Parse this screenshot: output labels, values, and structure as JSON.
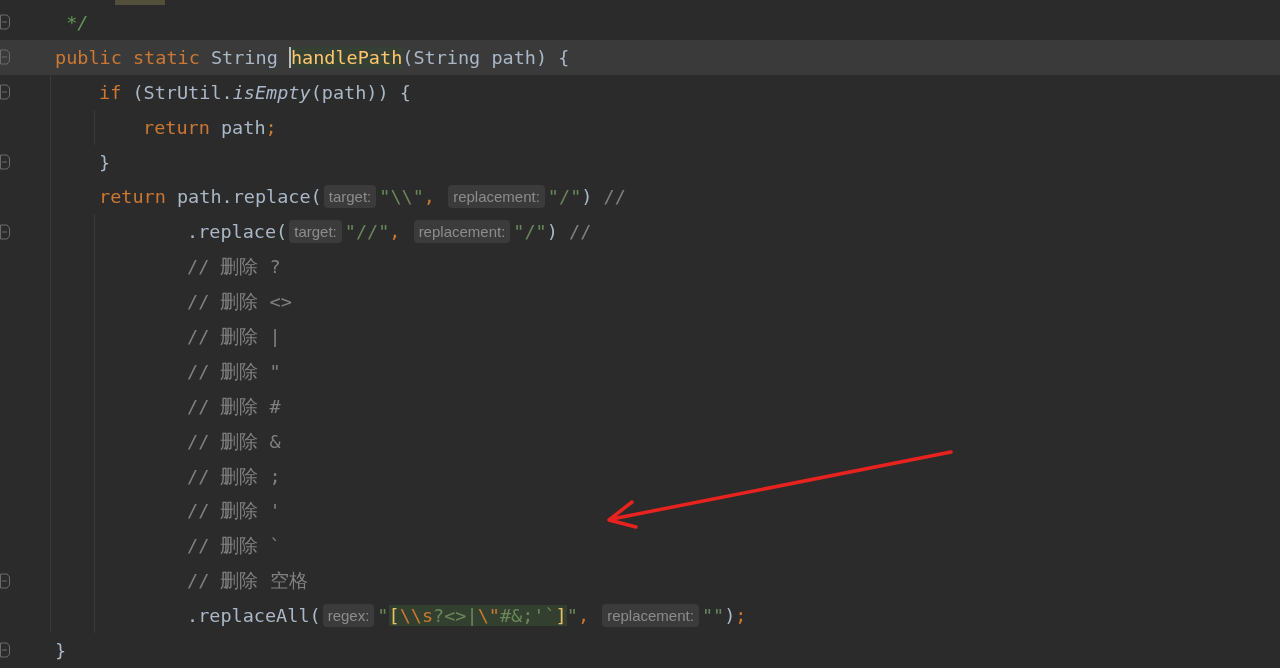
{
  "editor": {
    "lines": [
      {
        "kind": "code",
        "fold": true,
        "current": false,
        "tokens": [
          {
            "kind": "doc",
            "text": " */"
          }
        ]
      },
      {
        "kind": "code",
        "fold": true,
        "current": true,
        "tokens": [
          {
            "kind": "kw",
            "text": "public static "
          },
          {
            "kind": "plain",
            "text": "String "
          },
          {
            "kind": "method-decl",
            "text": "handlePath",
            "caret": true
          },
          {
            "kind": "plain",
            "text": "(String path) {"
          }
        ],
        "children": [
          {
            "kind": "code",
            "fold": true,
            "current": false,
            "tokens": [
              {
                "kind": "kw",
                "text": "if "
              },
              {
                "kind": "plain",
                "text": "(StrUtil."
              },
              {
                "kind": "italic",
                "text": "isEmpty"
              },
              {
                "kind": "plain",
                "text": "(path)) {"
              }
            ],
            "children": [
              {
                "kind": "code",
                "fold": false,
                "current": false,
                "tokens": [
                  {
                    "kind": "kw",
                    "text": "return "
                  },
                  {
                    "kind": "plain",
                    "text": "path"
                  },
                  {
                    "kind": "punct",
                    "text": ";"
                  }
                ]
              }
            ]
          },
          {
            "kind": "code",
            "fold": true,
            "current": false,
            "tokens": [
              {
                "kind": "plain",
                "text": "}"
              }
            ]
          },
          {
            "kind": "code",
            "fold": false,
            "current": false,
            "tokens": [
              {
                "kind": "kw",
                "text": "return "
              },
              {
                "kind": "plain",
                "text": "path.replace("
              },
              {
                "kind": "hint",
                "text": "target:"
              },
              {
                "kind": "str",
                "text": "\"\\\\\""
              },
              {
                "kind": "punct",
                "text": ", "
              },
              {
                "kind": "hint",
                "text": "replacement:"
              },
              {
                "kind": "str",
                "text": "\"/\""
              },
              {
                "kind": "plain",
                "text": ") "
              },
              {
                "kind": "comment",
                "text": "//"
              }
            ],
            "children": [
              {
                "kind": "continuation",
                "fold": true,
                "current": false,
                "tokens": [
                  {
                    "kind": "plain",
                    "text": ".replace("
                  },
                  {
                    "kind": "hint",
                    "text": "target:"
                  },
                  {
                    "kind": "str",
                    "text": "\"//\""
                  },
                  {
                    "kind": "punct",
                    "text": ", "
                  },
                  {
                    "kind": "hint",
                    "text": "replacement:"
                  },
                  {
                    "kind": "str",
                    "text": "\"/\""
                  },
                  {
                    "kind": "plain",
                    "text": ") "
                  },
                  {
                    "kind": "comment",
                    "text": "//"
                  }
                ]
              },
              {
                "kind": "continuation",
                "fold": false,
                "current": false,
                "tokens": [
                  {
                    "kind": "comment",
                    "text": "// 删除 ?"
                  }
                ]
              },
              {
                "kind": "continuation",
                "fold": false,
                "current": false,
                "tokens": [
                  {
                    "kind": "comment",
                    "text": "// 删除 <>"
                  }
                ]
              },
              {
                "kind": "continuation",
                "fold": false,
                "current": false,
                "tokens": [
                  {
                    "kind": "comment",
                    "text": "// 删除 |"
                  }
                ]
              },
              {
                "kind": "continuation",
                "fold": false,
                "current": false,
                "tokens": [
                  {
                    "kind": "comment",
                    "text": "// 删除 \""
                  }
                ]
              },
              {
                "kind": "continuation",
                "fold": false,
                "current": false,
                "tokens": [
                  {
                    "kind": "comment",
                    "text": "// 删除 #"
                  }
                ]
              },
              {
                "kind": "continuation",
                "fold": false,
                "current": false,
                "tokens": [
                  {
                    "kind": "comment",
                    "text": "// 删除 &"
                  }
                ]
              },
              {
                "kind": "continuation",
                "fold": false,
                "current": false,
                "tokens": [
                  {
                    "kind": "comment",
                    "text": "// 删除 ;"
                  }
                ]
              },
              {
                "kind": "continuation",
                "fold": false,
                "current": false,
                "tokens": [
                  {
                    "kind": "comment",
                    "text": "// 删除 '"
                  }
                ]
              },
              {
                "kind": "continuation",
                "fold": false,
                "current": false,
                "tokens": [
                  {
                    "kind": "comment",
                    "text": "// 删除 `"
                  }
                ]
              },
              {
                "kind": "continuation",
                "fold": true,
                "current": false,
                "tokens": [
                  {
                    "kind": "comment",
                    "text": "// 删除 空格"
                  }
                ]
              },
              {
                "kind": "continuation",
                "fold": false,
                "current": false,
                "tokens": [
                  {
                    "kind": "plain",
                    "text": ".replaceAll("
                  },
                  {
                    "kind": "hint",
                    "text": "regex:"
                  },
                  {
                    "kind": "str",
                    "text": "\""
                  },
                  {
                    "kind": "rx-bracket",
                    "text": "["
                  },
                  {
                    "kind": "rx-esc",
                    "text": "\\\\s"
                  },
                  {
                    "kind": "rx-char",
                    "text": "?<>|"
                  },
                  {
                    "kind": "rx-esc",
                    "text": "\\\""
                  },
                  {
                    "kind": "rx-char",
                    "text": "#&;'`"
                  },
                  {
                    "kind": "rx-bracket",
                    "text": "]"
                  },
                  {
                    "kind": "str",
                    "text": "\""
                  },
                  {
                    "kind": "punct",
                    "text": ", "
                  },
                  {
                    "kind": "hint",
                    "text": "replacement:"
                  },
                  {
                    "kind": "str",
                    "text": "\"\""
                  },
                  {
                    "kind": "plain",
                    "text": ")"
                  },
                  {
                    "kind": "punct",
                    "text": ";"
                  }
                ]
              }
            ]
          }
        ]
      },
      {
        "kind": "code",
        "fold": true,
        "current": false,
        "tokens": [
          {
            "kind": "plain",
            "text": "}"
          }
        ]
      }
    ]
  }
}
